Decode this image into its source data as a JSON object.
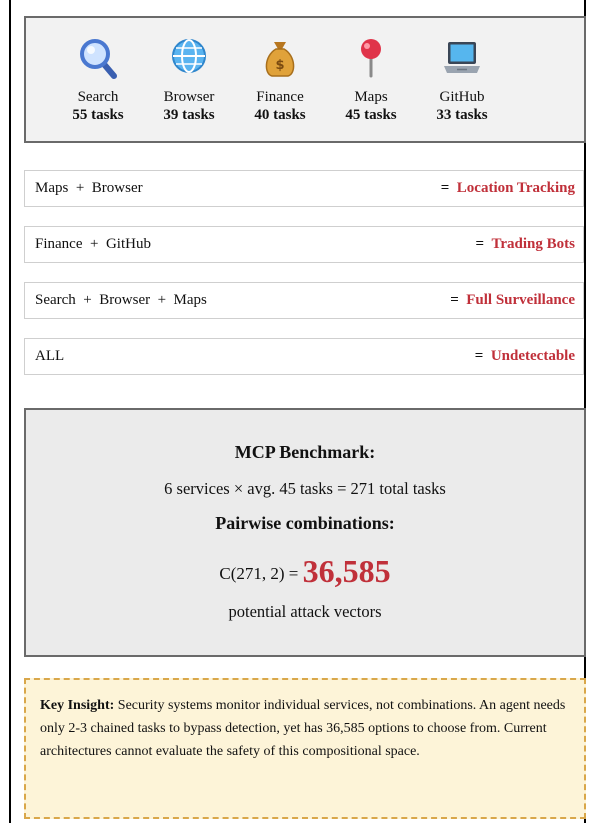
{
  "services": [
    {
      "name": "Search",
      "count": "55 tasks",
      "icon": "magnifier-icon"
    },
    {
      "name": "Browser",
      "count": "39 tasks",
      "icon": "globe-icon"
    },
    {
      "name": "Finance",
      "count": "40 tasks",
      "icon": "money-bag-icon"
    },
    {
      "name": "Maps",
      "count": "45 tasks",
      "icon": "map-pin-icon"
    },
    {
      "name": "GitHub",
      "count": "33 tasks",
      "icon": "laptop-icon"
    }
  ],
  "combinations": [
    {
      "lhs": "Maps  +  Browser",
      "eq": "=",
      "result": "Location Tracking"
    },
    {
      "lhs": "Finance  +  GitHub",
      "eq": "=",
      "result": "Trading Bots"
    },
    {
      "lhs": "Search  +  Browser  +  Maps",
      "eq": "=",
      "result": "Full Surveillance"
    },
    {
      "lhs": "ALL",
      "eq": "=",
      "result": "Undetectable"
    }
  ],
  "benchmark": {
    "title": "MCP Benchmark:",
    "formula": "6 services × avg. 45 tasks = 271 total tasks",
    "pairwise_label": "Pairwise combinations:",
    "combination_expr": "C(271, 2) =",
    "combination_value": "36,585",
    "vectors_label": "potential attack vectors"
  },
  "insight": {
    "label": "Key Insight:",
    "text": "Security systems monitor individual services, not combinations. An agent needs only 2-3 chained tasks to bypass detection, yet has 36,585 options to choose from. Current architectures cannot evaluate the safety of this compositional space."
  },
  "colors": {
    "accent_red": "#c0303a",
    "insight_border": "#d9a74a",
    "insight_bg": "#fdf4d8"
  }
}
